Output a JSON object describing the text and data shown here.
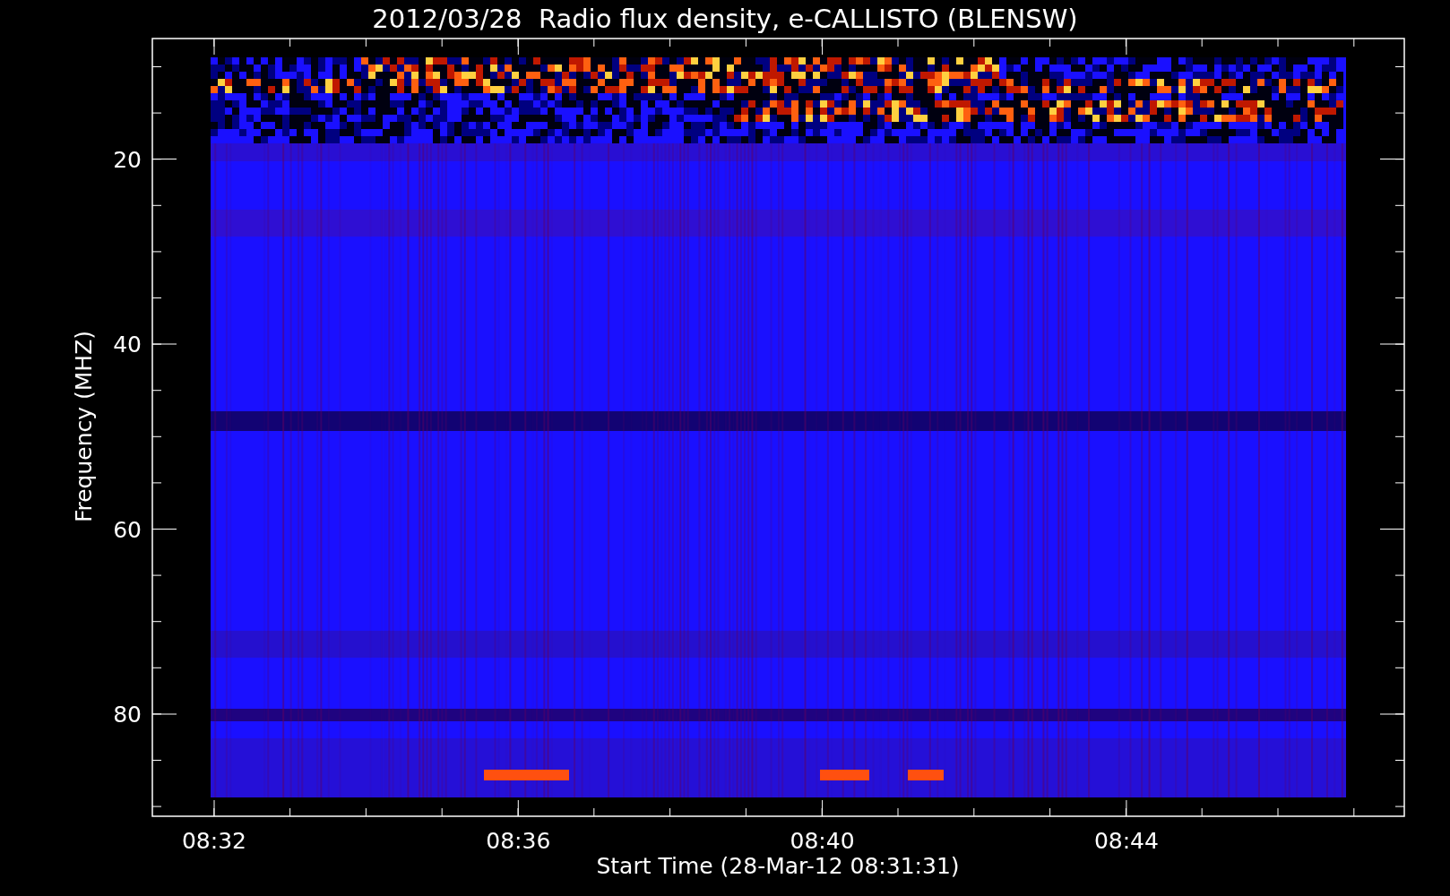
{
  "title": "2012/03/28  Radio flux density, e-CALLISTO (BLENSW)",
  "y_axis": {
    "label": "Frequency (MHZ)",
    "ticks": [
      "20",
      "40",
      "60",
      "80"
    ]
  },
  "x_axis": {
    "label": "Start Time (28-Mar-12 08:31:31)",
    "ticks": [
      "08:32",
      "08:36",
      "08:40",
      "08:44"
    ]
  }
}
